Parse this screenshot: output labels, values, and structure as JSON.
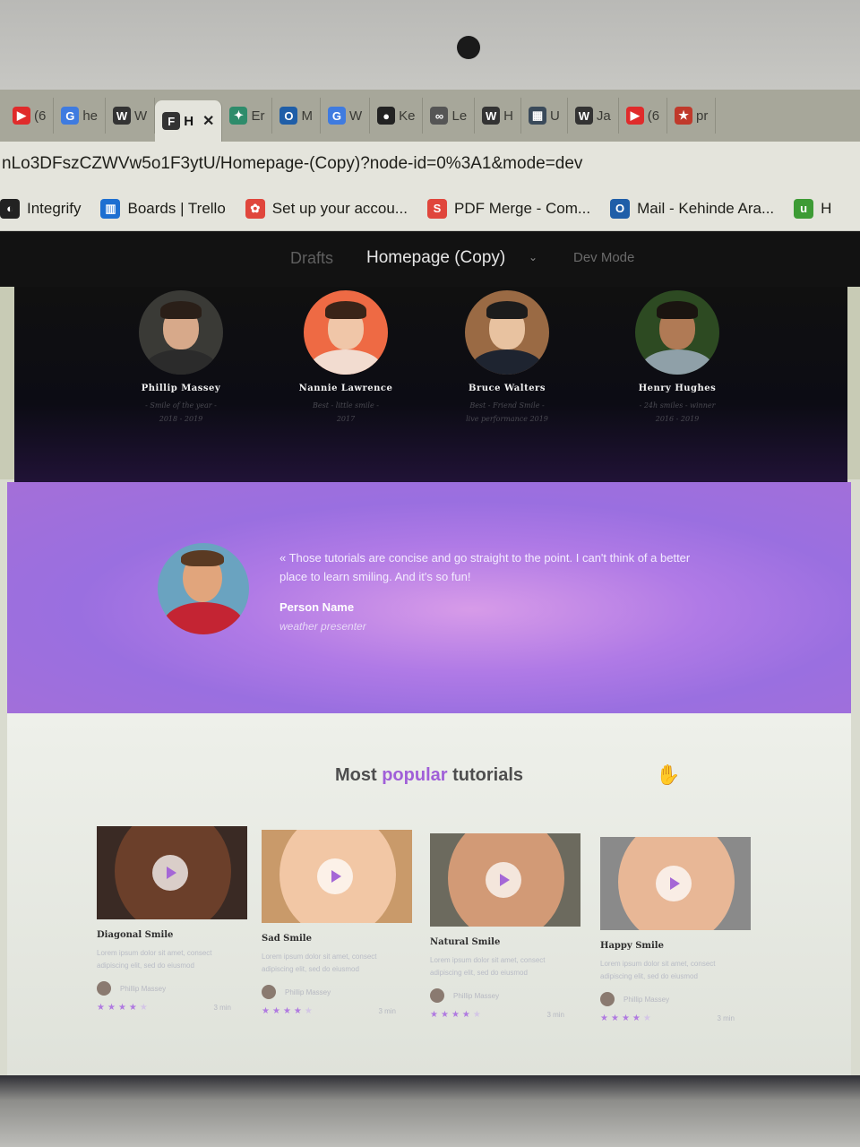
{
  "browser": {
    "tabs": [
      {
        "icon": "youtube-icon",
        "label": "(6",
        "color": "#e02b2b"
      },
      {
        "icon": "google-icon",
        "label": "he",
        "color": "#3f7be0"
      },
      {
        "icon": "w-icon",
        "label": "W",
        "color": "#333333"
      },
      {
        "icon": "figma-icon",
        "label": "H",
        "color": "#333333",
        "active": true
      },
      {
        "icon": "openai-icon",
        "label": "Er",
        "color": "#2e8c6b"
      },
      {
        "icon": "outlook-icon",
        "label": "M",
        "color": "#1f5ea8"
      },
      {
        "icon": "google-icon",
        "label": "W",
        "color": "#3f7be0"
      },
      {
        "icon": "github-icon",
        "label": "Ke",
        "color": "#222222"
      },
      {
        "icon": "link-icon",
        "label": "Le",
        "color": "#555555"
      },
      {
        "icon": "w-icon",
        "label": "H",
        "color": "#333333"
      },
      {
        "icon": "grid-icon",
        "label": "U",
        "color": "#3a4a5a"
      },
      {
        "icon": "w-icon",
        "label": "Ja",
        "color": "#333333"
      },
      {
        "icon": "youtube-icon",
        "label": "(6",
        "color": "#e02b2b"
      },
      {
        "icon": "star-icon",
        "label": "pr",
        "color": "#c0392b"
      }
    ],
    "url": "nLo3DFszCZWVw5o1F3ytU/Homepage-(Copy)?node-id=0%3A1&mode=dev",
    "bookmarks": [
      {
        "icon": "integrify-icon",
        "label": "Integrify",
        "color": "#222222"
      },
      {
        "icon": "trello-icon",
        "label": "Boards | Trello",
        "color": "#1d6fd1"
      },
      {
        "icon": "cluster-icon",
        "label": "Set up your accou...",
        "color": "#e0463c"
      },
      {
        "icon": "pdf-merge-icon",
        "label": "PDF Merge - Com...",
        "color": "#e0463c"
      },
      {
        "icon": "outlook-icon",
        "label": "Mail - Kehinde Ara...",
        "color": "#1f5ea8"
      },
      {
        "icon": "upwork-icon",
        "label": "H",
        "color": "#3d9b35"
      }
    ]
  },
  "figma": {
    "drafts": "Drafts",
    "title": "Homepage (Copy)",
    "chevron": "⌄",
    "dev_mode": "Dev Mode"
  },
  "team": {
    "members": [
      {
        "name": "Phillip Massey",
        "desc1": "- Smile of the year -",
        "desc2": "2018 - 2019",
        "bg": "#3a3a36",
        "skin": "#d7a98a",
        "hair": "#2a1f18",
        "shirt": "#2b2b2b"
      },
      {
        "name": "Nannie Lawrence",
        "desc1": "Best - little smile -",
        "desc2": "2017",
        "bg": "#ee6a44",
        "skin": "#f0c6a8",
        "hair": "#3a2418",
        "shirt": "#f2dcd0"
      },
      {
        "name": "Bruce Walters",
        "desc1": "Best - Friend Smile -",
        "desc2": "live performance 2019",
        "bg": "#9a6a44",
        "skin": "#e8c2a0",
        "hair": "#1c1c1c",
        "shirt": "#1e2430"
      },
      {
        "name": "Henry Hughes",
        "desc1": "- 24h smiles - winner",
        "desc2": "2016 - 2019",
        "bg": "#2d4a22",
        "skin": "#b07a55",
        "hair": "#1a1410",
        "shirt": "#8fa0a8"
      }
    ]
  },
  "testimonial": {
    "quote": "« Those tutorials are concise and go straight to the point. I can't think of a better place to learn smiling. And it's so fun!",
    "name": "Person Name",
    "role": "weather presenter"
  },
  "tutorials": {
    "heading_pre": "Most ",
    "heading_hl": "popular",
    "heading_post": " tutorials",
    "cards": [
      {
        "title": "Diagonal Smile",
        "text": "Lorem ipsum dolor sit amet, consect adipiscing elit, sed do eiusmod",
        "author": "Phillip Massey",
        "duration": "3 min",
        "rating": 4,
        "bg": "#3a2a24",
        "skin": "#6b3f2a"
      },
      {
        "title": "Sad Smile",
        "text": "Lorem ipsum dolor sit amet, consect adipiscing elit, sed do eiusmod",
        "author": "Phillip Massey",
        "duration": "3 min",
        "rating": 4,
        "bg": "#c99a6a",
        "skin": "#f2c7a5"
      },
      {
        "title": "Natural Smile",
        "text": "Lorem ipsum dolor sit amet, consect adipiscing elit, sed do eiusmod",
        "author": "Phillip Massey",
        "duration": "3 min",
        "rating": 4,
        "bg": "#6c6a5e",
        "skin": "#d29a76"
      },
      {
        "title": "Happy Smile",
        "text": "Lorem ipsum dolor sit amet, consect adipiscing elit, sed do eiusmod",
        "author": "Phillip Massey",
        "duration": "3 min",
        "rating": 4,
        "bg": "#8a8a8a",
        "skin": "#e8b796"
      }
    ]
  }
}
